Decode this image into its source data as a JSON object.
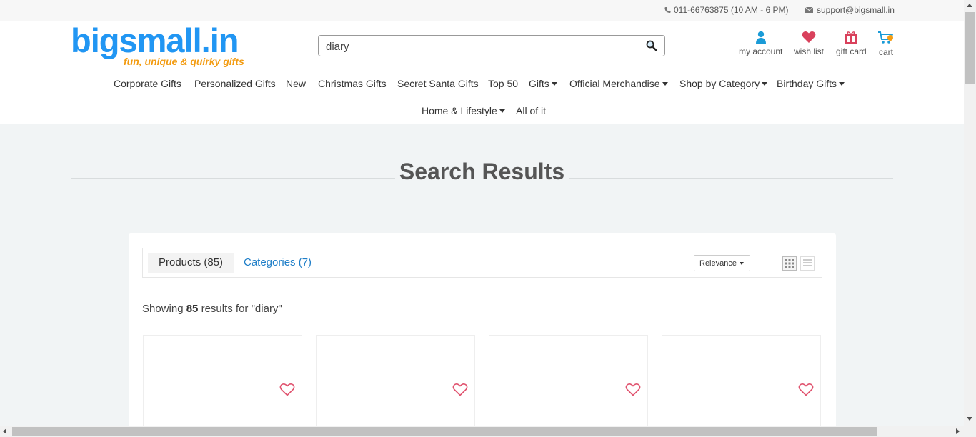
{
  "topbar": {
    "phone": "011-66763875 (10 AM - 6 PM)",
    "email": "support@bigsmall.in",
    "phone_icon": "phone-icon",
    "email_icon": "envelope-icon"
  },
  "brand": {
    "logo_text": "bigsmall.in",
    "tagline": "fun, unique & quirky gifts",
    "primary_color": "#2196f3",
    "accent_color": "#f39c12"
  },
  "search": {
    "value": "diary",
    "icon": "search-icon"
  },
  "header_icons": [
    {
      "label": "my account",
      "icon": "user-icon",
      "color": "#1a9bd7"
    },
    {
      "label": "wish list",
      "icon": "heart-icon",
      "color": "#d9415c"
    },
    {
      "label": "gift card",
      "icon": "gift-icon",
      "color": "#d9415c"
    },
    {
      "label": "cart",
      "icon": "cart-icon",
      "color": "#1a9bd7"
    }
  ],
  "nav": {
    "items": [
      {
        "label": "Corporate Gifts",
        "dropdown": false
      },
      {
        "label": "Personalized Gifts",
        "dropdown": false
      },
      {
        "label": "New",
        "dropdown": false
      },
      {
        "label": "Christmas Gifts",
        "dropdown": false
      },
      {
        "label": "Secret Santa Gifts",
        "dropdown": false
      },
      {
        "label": "Top 50",
        "dropdown": false
      },
      {
        "label": "Gifts",
        "dropdown": true
      },
      {
        "label": "Official Merchandise",
        "dropdown": true
      },
      {
        "label": "Shop by Category",
        "dropdown": true
      },
      {
        "label": "Birthday Gifts",
        "dropdown": true
      },
      {
        "label": "Home & Lifestyle",
        "dropdown": true
      },
      {
        "label": "All of it",
        "dropdown": false
      }
    ]
  },
  "results": {
    "title": "Search Results",
    "tabs": [
      {
        "label": "Products (85)",
        "active": true
      },
      {
        "label": "Categories (7)",
        "active": false
      }
    ],
    "sort": {
      "selected": "Relevance"
    },
    "view_modes": [
      "grid-view-icon",
      "list-view-icon"
    ],
    "showing_prefix": "Showing",
    "showing_count": "85",
    "showing_suffix": "results for \"diary\"",
    "products": [
      {
        "wishlist_icon": "heart-outline-icon"
      },
      {
        "wishlist_icon": "heart-outline-icon"
      },
      {
        "wishlist_icon": "heart-outline-icon"
      },
      {
        "wishlist_icon": "heart-outline-icon"
      }
    ]
  }
}
